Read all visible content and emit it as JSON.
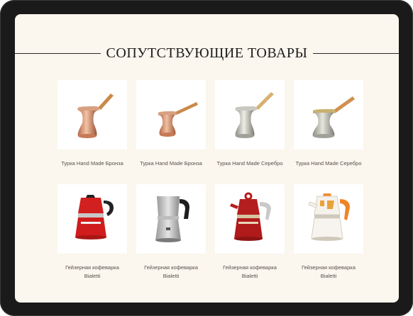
{
  "section": {
    "title": "СОПУТСТВУЮЩИЕ ТОВАРЫ"
  },
  "products": [
    {
      "name": "Турка Hand Made Бронза",
      "icon": "copper-turka-icon"
    },
    {
      "name": "Турка Hand Made Бронза",
      "icon": "copper-turka-icon"
    },
    {
      "name": "Турка Hand Made Серебро",
      "icon": "silver-turka-icon"
    },
    {
      "name": "Турка Hand Made Серебро",
      "icon": "silver-turka-icon"
    },
    {
      "name": "Гейзерная кофеварка Bialetti",
      "icon": "red-moka-pot-icon"
    },
    {
      "name": "Гейзерная кофеварка Bialetti",
      "icon": "steel-moka-pot-icon"
    },
    {
      "name": "Гейзерная кофеварка Bialetti",
      "icon": "red-moka-pot-icon"
    },
    {
      "name": "Гейзерная кофеварка Bialetti",
      "icon": "white-moka-pot-icon"
    }
  ],
  "colors": {
    "background": "#fbf6ee",
    "frame": "#1a1a1a",
    "text": "#55504a"
  }
}
